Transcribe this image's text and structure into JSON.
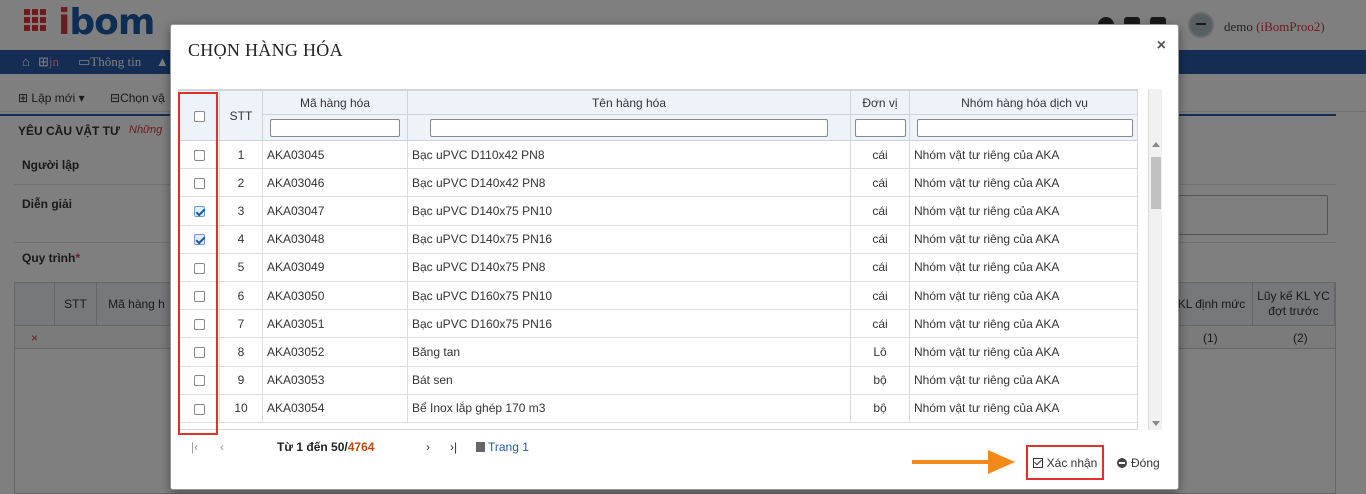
{
  "app": {
    "logo_text": "ibom",
    "user": "demo",
    "tenant": "(iBomProo2)",
    "nav": [
      {
        "label": "jn",
        "icon": "home-icon"
      },
      {
        "label": "Thông tin",
        "icon": "window-icon"
      }
    ],
    "toolbar": {
      "new_label": "Lập mới",
      "choose_label": "Chọn vậ"
    },
    "section_title": "YÊU CẦU VẬT TƯ",
    "section_sub": "Những",
    "form": {
      "creator_label": "Người lập",
      "description_label": "Diễn giải",
      "process_label": "Quy trình",
      "required_mark": "*"
    },
    "bg_table": {
      "headers": [
        "STT",
        "Mã hàng h",
        "KL định mức",
        "Lũy kế KL YC đợt trước"
      ],
      "row_marks": [
        "(1)",
        "(2)"
      ],
      "delete_icon": "×"
    }
  },
  "modal": {
    "title": "CHỌN HÀNG HÓA",
    "close_icon": "×",
    "columns": {
      "stt": "STT",
      "code": "Mã hàng hóa",
      "name": "Tên hàng hóa",
      "unit": "Đơn vị",
      "group": "Nhóm hàng hóa dịch vụ"
    },
    "rows": [
      {
        "checked": false,
        "stt": "1",
        "code": "AKA03045",
        "name": "Bạc uPVC D110x42 PN8",
        "unit": "cái",
        "group": "Nhóm vật tư riêng của AKA"
      },
      {
        "checked": false,
        "stt": "2",
        "code": "AKA03046",
        "name": "Bạc uPVC D140x42 PN8",
        "unit": "cái",
        "group": "Nhóm vật tư riêng của AKA"
      },
      {
        "checked": true,
        "stt": "3",
        "code": "AKA03047",
        "name": "Bạc uPVC D140x75 PN10",
        "unit": "cái",
        "group": "Nhóm vật tư riêng của AKA"
      },
      {
        "checked": true,
        "stt": "4",
        "code": "AKA03048",
        "name": "Bạc uPVC D140x75 PN16",
        "unit": "cái",
        "group": "Nhóm vật tư riêng của AKA"
      },
      {
        "checked": false,
        "stt": "5",
        "code": "AKA03049",
        "name": "Bạc uPVC D140x75 PN8",
        "unit": "cái",
        "group": "Nhóm vật tư riêng của AKA"
      },
      {
        "checked": false,
        "stt": "6",
        "code": "AKA03050",
        "name": "Bạc uPVC D160x75 PN10",
        "unit": "cái",
        "group": "Nhóm vật tư riêng của AKA"
      },
      {
        "checked": false,
        "stt": "7",
        "code": "AKA03051",
        "name": "Bạc uPVC D160x75 PN16",
        "unit": "cái",
        "group": "Nhóm vật tư riêng của AKA"
      },
      {
        "checked": false,
        "stt": "8",
        "code": "AKA03052",
        "name": "Băng tan",
        "unit": "Lô",
        "group": "Nhóm vật tư riêng của AKA"
      },
      {
        "checked": false,
        "stt": "9",
        "code": "AKA03053",
        "name": "Bát sen",
        "unit": "bộ",
        "group": "Nhóm vật tư riêng của AKA"
      },
      {
        "checked": false,
        "stt": "10",
        "code": "AKA03054",
        "name": "Bể Inox lắp ghép 170 m3",
        "unit": "bộ",
        "group": "Nhóm vật tư riêng của AKA"
      }
    ],
    "pager": {
      "first": "|‹",
      "prev": "‹",
      "next": "›",
      "last": "›|",
      "range_text": "Từ 1 đến 50/",
      "total": "4764",
      "page_label": "Trang 1"
    },
    "confirm_label": "Xác nhận",
    "close_label": "Đóng"
  },
  "colors": {
    "nav_blue": "#2a5aa8",
    "highlight_red": "#e0312b",
    "arrow_orange": "#f28a1a"
  }
}
